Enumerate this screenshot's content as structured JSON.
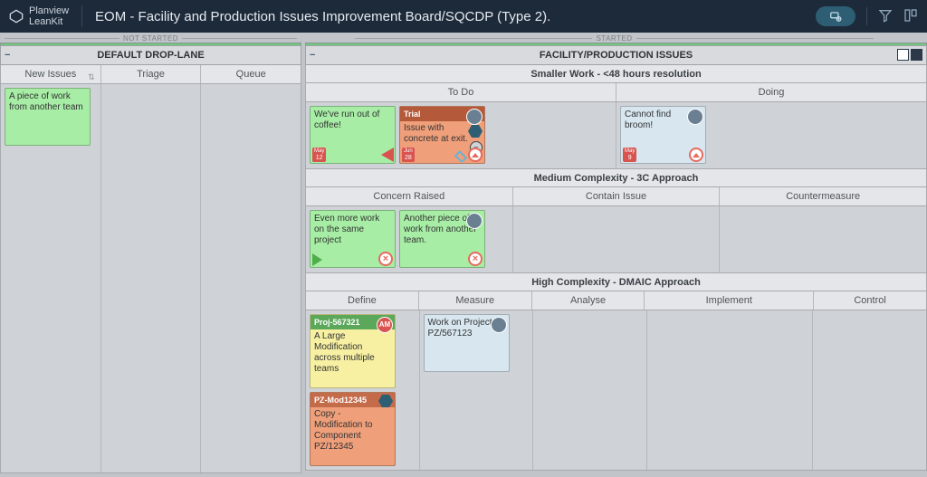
{
  "app": {
    "name": "Planview",
    "sub": "LeanKit"
  },
  "board_title": "EOM - Facility and Production Issues Improvement Board/SQCDP (Type 2).",
  "status_labels": {
    "not_started": "NOT STARTED",
    "started": "STARTED"
  },
  "left_lane": {
    "title": "DEFAULT DROP-LANE",
    "columns": [
      "New Issues",
      "Triage",
      "Queue"
    ],
    "cards": [
      {
        "col": 0,
        "color": "green",
        "text": "A piece of work from another team"
      }
    ]
  },
  "right_lane": {
    "title": "FACILITY/PRODUCTION ISSUES",
    "swimlanes": [
      {
        "title": "Smaller Work - <48 hours resolution",
        "columns": [
          "To Do",
          "Doing"
        ],
        "cells": [
          {
            "col": 0,
            "cards": [
              {
                "color": "green",
                "text": "We've run out of coffee!",
                "footer": {
                  "arrow": true,
                  "date": {
                    "m": "May",
                    "d": "12"
                  },
                  "warn": true
                }
              },
              {
                "color": "orange",
                "header": "Trial",
                "headerClass": "org",
                "text": "Issue with concrete at exit.",
                "avatar": true,
                "hex": true,
                "smallround": "–",
                "footer": {
                  "arrow": true,
                  "date": {
                    "m": "Jun",
                    "d": "28"
                  },
                  "tags": true
                },
                "circ": "up"
              }
            ]
          },
          {
            "col": 1,
            "cards": [
              {
                "color": "blue",
                "text": "Cannot find broom!",
                "avatar": true,
                "footer": {
                  "date": {
                    "m": "May",
                    "d": "9"
                  }
                },
                "circ": "up"
              }
            ]
          }
        ]
      },
      {
        "title": "Medium Complexity - 3C Approach",
        "columns": [
          "Concern Raised",
          "Contain Issue",
          "Countermeasure"
        ],
        "cells": [
          {
            "col": 0,
            "cards": [
              {
                "color": "green",
                "text": "Even more work on the same project",
                "footer": {
                  "arrow": true
                },
                "circ": "x"
              },
              {
                "color": "green",
                "text": "Another piece of work from another team.",
                "avatar": true,
                "circ": "x"
              }
            ]
          },
          {
            "col": 1,
            "cards": []
          },
          {
            "col": 2,
            "cards": []
          }
        ]
      },
      {
        "title": "High Complexity - DMAIC Approach",
        "columns": [
          "Define",
          "Measure",
          "Analyse",
          "Implement",
          "Control"
        ],
        "cells": [
          {
            "col": 0,
            "cards": [
              {
                "color": "yellow",
                "header": "Proj-567321",
                "headerClass": "grn",
                "text": "A Large Modification across multiple teams",
                "avatarTxt": "AM"
              },
              {
                "color": "orange",
                "header": "PZ-Mod12345",
                "headerClass": "oor",
                "text": "Copy - Modification to Component PZ/12345",
                "hexTop": true
              }
            ]
          },
          {
            "col": 1,
            "cards": [
              {
                "color": "blue",
                "text": "Work on Project PZ/567123",
                "avatar": true
              }
            ]
          },
          {
            "col": 2,
            "cards": []
          },
          {
            "col": 3,
            "cards": []
          },
          {
            "col": 4,
            "cards": []
          }
        ]
      }
    ]
  }
}
